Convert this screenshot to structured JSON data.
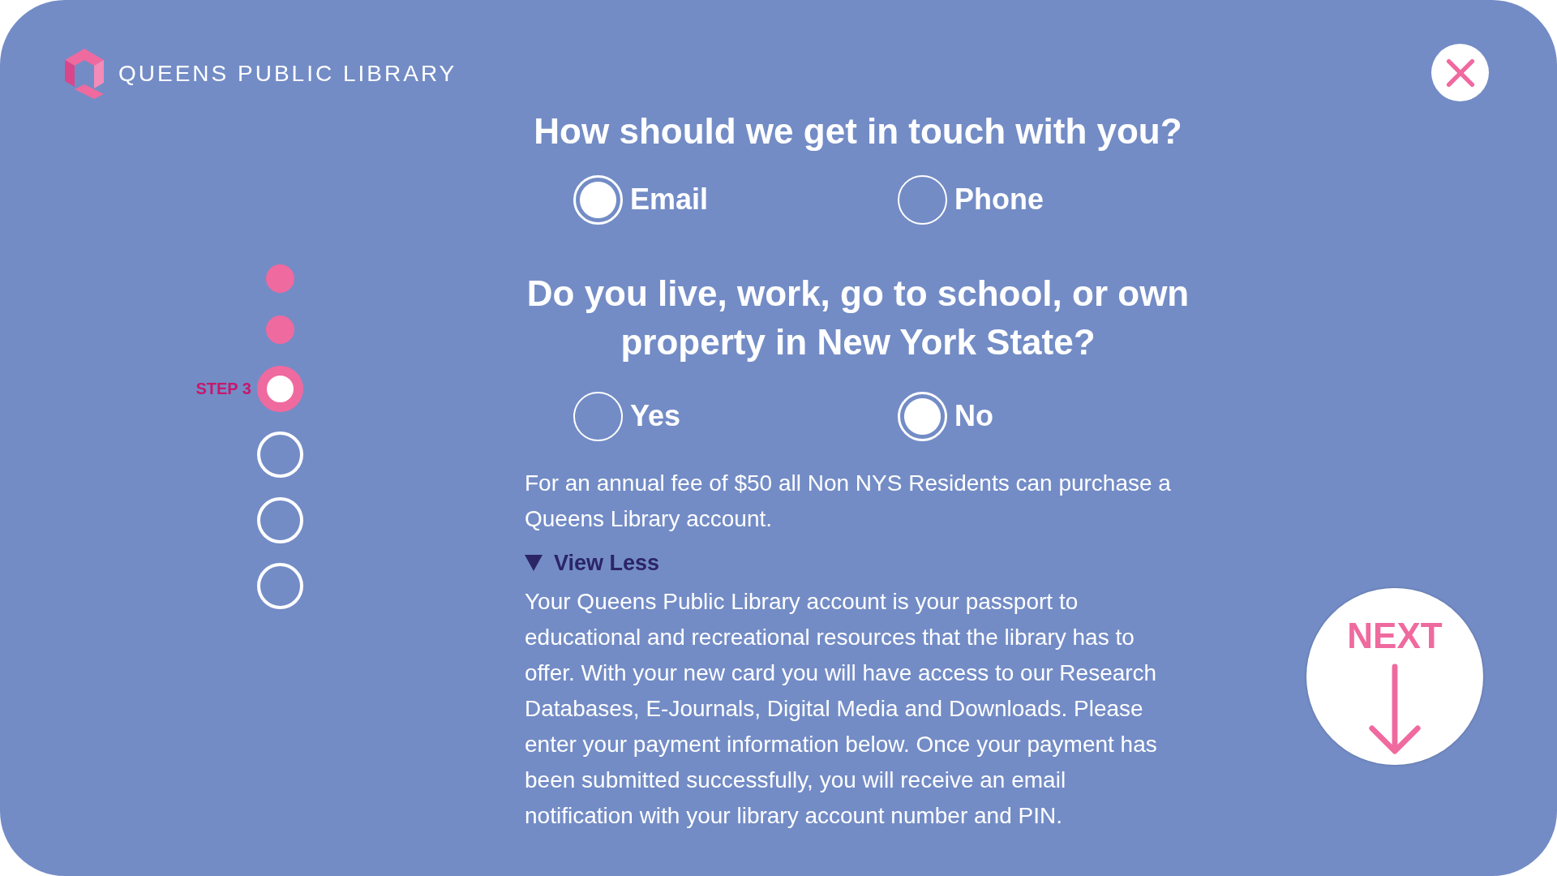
{
  "brand": {
    "name": "QUEENS PUBLIC LIBRARY"
  },
  "steps": [
    {
      "completed": true,
      "selected": false
    },
    {
      "completed": true,
      "selected": false
    },
    {
      "completed": false,
      "selected": true,
      "label": "STEP 3"
    },
    {
      "completed": false,
      "selected": false
    },
    {
      "completed": false,
      "selected": false
    },
    {
      "completed": false,
      "selected": false
    }
  ],
  "questions": [
    {
      "title": "How should we get in touch with you?",
      "options": [
        {
          "label": "Email",
          "selected": true
        },
        {
          "label": "Phone",
          "selected": false
        }
      ]
    },
    {
      "title": "Do you live, work, go to school, or own property in New York State?",
      "options": [
        {
          "label": "Yes",
          "selected": false
        },
        {
          "label": "No",
          "selected": true
        }
      ]
    }
  ],
  "fee_note": "For an annual fee of $50 all Non NYS Residents can purchase a Queens Library account.",
  "details": {
    "toggle": "View Less",
    "expanded": true,
    "text": "Your Queens Public Library account is your passport to educational and recreational resources that the library has to offer. With your new card you will have access to our Research Databases, E-Journals, Digital Media and Downloads. Please enter your payment information below. Once your payment has been submitted successfully, you will receive an email notification with your library account number and PIN."
  },
  "next_button": {
    "label": "NEXT"
  }
}
